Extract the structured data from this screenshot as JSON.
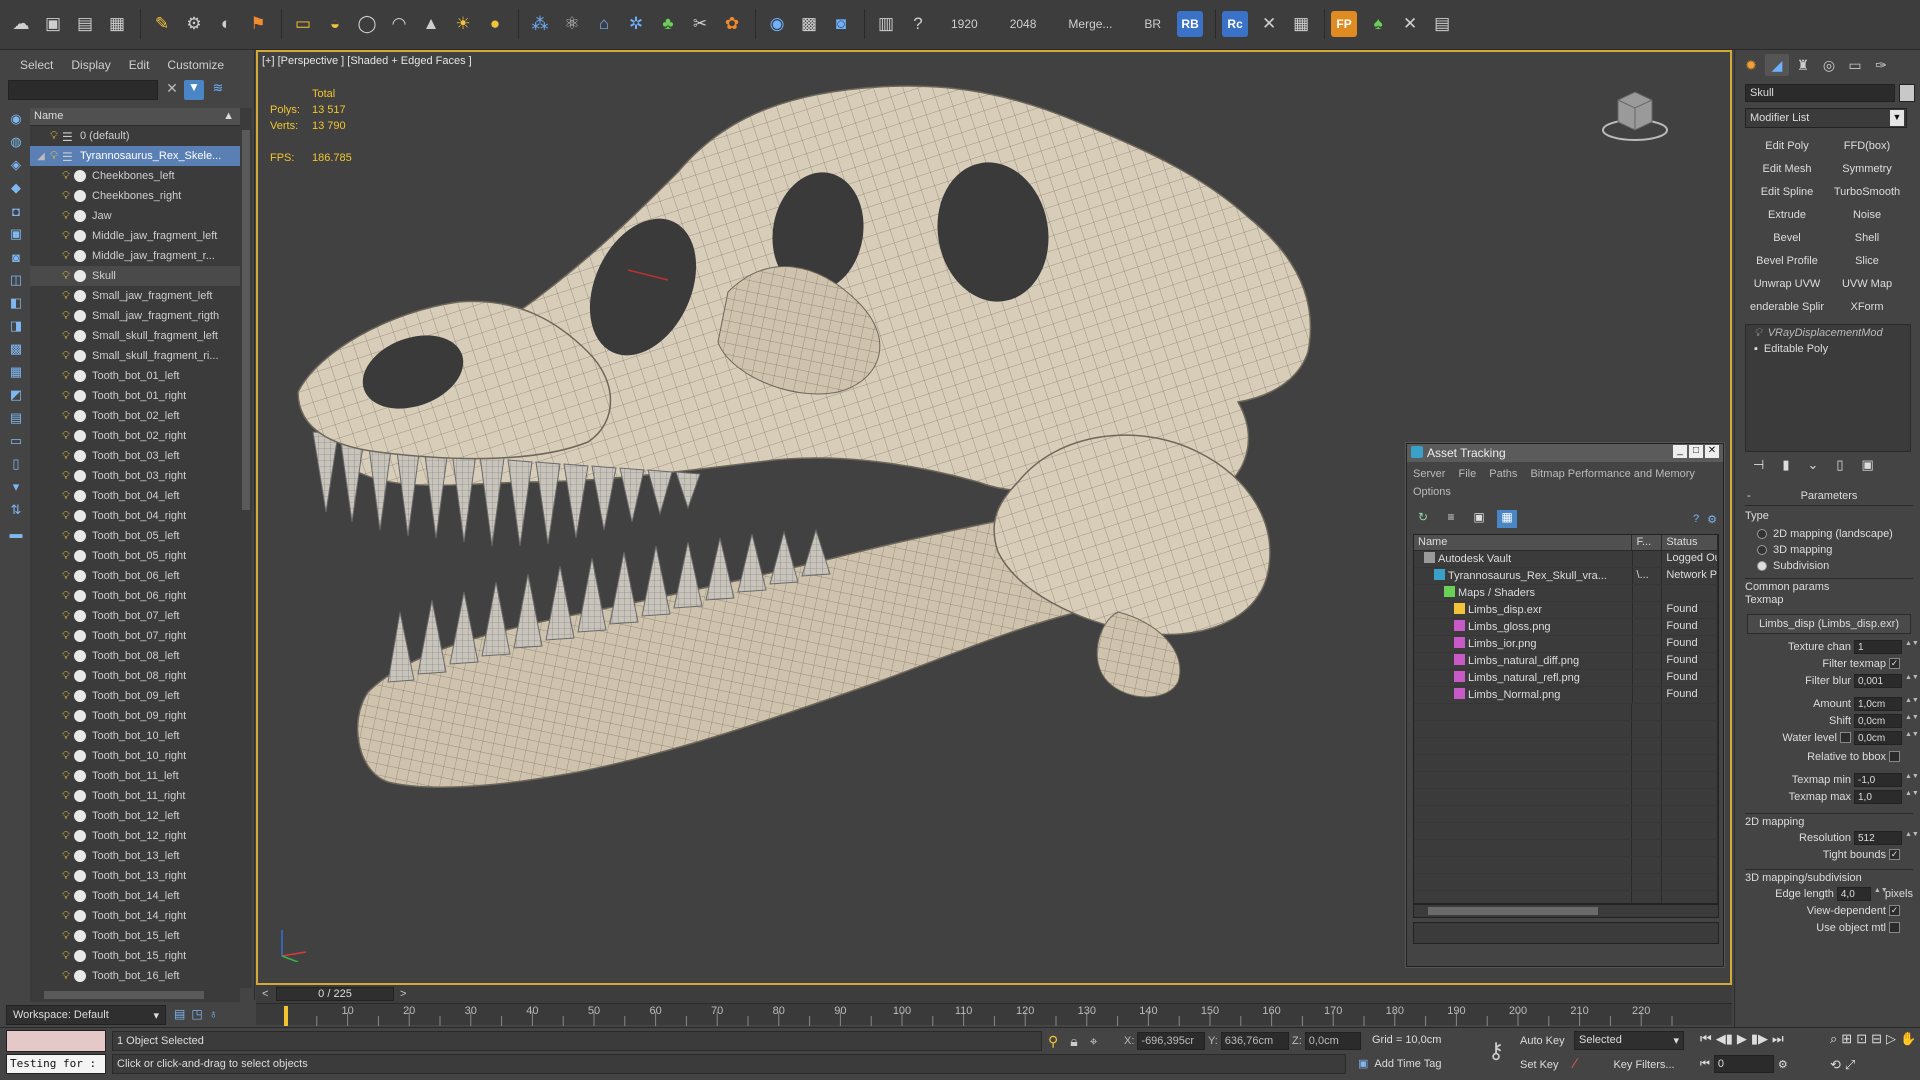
{
  "toolbar": {
    "res_width": "1920",
    "res_height": "2048",
    "merge_label": "Merge...",
    "br_label": "BR",
    "rb_badge": "RB",
    "rc_badge": "Rc",
    "fp_badge": "FP"
  },
  "explorer": {
    "menu": [
      "Select",
      "Display",
      "Edit",
      "Customize"
    ],
    "column_header": "Name",
    "rows": [
      {
        "label": "0 (default)",
        "type": "layer",
        "expanded": false
      },
      {
        "label": "Tyrannosaurus_Rex_Skele...",
        "type": "layer",
        "expanded": true,
        "highlight": true
      },
      {
        "label": "Cheekbones_left",
        "type": "object"
      },
      {
        "label": "Cheekbones_right",
        "type": "object"
      },
      {
        "label": "Jaw",
        "type": "object"
      },
      {
        "label": "Middle_jaw_fragment_left",
        "type": "object"
      },
      {
        "label": "Middle_jaw_fragment_r...",
        "type": "object"
      },
      {
        "label": "Skull",
        "type": "object",
        "selected": true
      },
      {
        "label": "Small_jaw_fragment_left",
        "type": "object"
      },
      {
        "label": "Small_jaw_fragment_rigth",
        "type": "object"
      },
      {
        "label": "Small_skull_fragment_left",
        "type": "object"
      },
      {
        "label": "Small_skull_fragment_ri...",
        "type": "object"
      },
      {
        "label": "Tooth_bot_01_left",
        "type": "object"
      },
      {
        "label": "Tooth_bot_01_right",
        "type": "object"
      },
      {
        "label": "Tooth_bot_02_left",
        "type": "object"
      },
      {
        "label": "Tooth_bot_02_right",
        "type": "object"
      },
      {
        "label": "Tooth_bot_03_left",
        "type": "object"
      },
      {
        "label": "Tooth_bot_03_right",
        "type": "object"
      },
      {
        "label": "Tooth_bot_04_left",
        "type": "object"
      },
      {
        "label": "Tooth_bot_04_right",
        "type": "object"
      },
      {
        "label": "Tooth_bot_05_left",
        "type": "object"
      },
      {
        "label": "Tooth_bot_05_right",
        "type": "object"
      },
      {
        "label": "Tooth_bot_06_left",
        "type": "object"
      },
      {
        "label": "Tooth_bot_06_right",
        "type": "object"
      },
      {
        "label": "Tooth_bot_07_left",
        "type": "object"
      },
      {
        "label": "Tooth_bot_07_right",
        "type": "object"
      },
      {
        "label": "Tooth_bot_08_left",
        "type": "object"
      },
      {
        "label": "Tooth_bot_08_right",
        "type": "object"
      },
      {
        "label": "Tooth_bot_09_left",
        "type": "object"
      },
      {
        "label": "Tooth_bot_09_right",
        "type": "object"
      },
      {
        "label": "Tooth_bot_10_left",
        "type": "object"
      },
      {
        "label": "Tooth_bot_10_right",
        "type": "object"
      },
      {
        "label": "Tooth_bot_11_left",
        "type": "object"
      },
      {
        "label": "Tooth_bot_11_right",
        "type": "object"
      },
      {
        "label": "Tooth_bot_12_left",
        "type": "object"
      },
      {
        "label": "Tooth_bot_12_right",
        "type": "object"
      },
      {
        "label": "Tooth_bot_13_left",
        "type": "object"
      },
      {
        "label": "Tooth_bot_13_right",
        "type": "object"
      },
      {
        "label": "Tooth_bot_14_left",
        "type": "object"
      },
      {
        "label": "Tooth_bot_14_right",
        "type": "object"
      },
      {
        "label": "Tooth_bot_15_left",
        "type": "object"
      },
      {
        "label": "Tooth_bot_15_right",
        "type": "object"
      },
      {
        "label": "Tooth_bot_16_left",
        "type": "object"
      }
    ],
    "workspace": "Workspace: Default"
  },
  "viewport": {
    "label": "[+] [Perspective ] [Shaded + Edged Faces ]",
    "stats_header": "Total",
    "polys_label": "Polys:",
    "polys_value": "13 517",
    "verts_label": "Verts:",
    "verts_value": "13 790",
    "fps_label": "FPS:",
    "fps_value": "186.785"
  },
  "timeline": {
    "frame_display": "0 / 225",
    "ticks": [
      "10",
      "20",
      "30",
      "40",
      "50",
      "60",
      "70",
      "80",
      "90",
      "100",
      "110",
      "120",
      "130",
      "140",
      "150",
      "160",
      "170",
      "180",
      "190",
      "200",
      "210",
      "220"
    ]
  },
  "status": {
    "maxscript_output": "Testing for :",
    "selection": "1 Object Selected",
    "prompt": "Click or click-and-drag to select objects",
    "x_label": "X:",
    "x_value": "-696,395cr",
    "y_label": "Y:",
    "y_value": "636,76cm",
    "z_label": "Z:",
    "z_value": "0,0cm",
    "grid": "Grid = 10,0cm",
    "add_time_tag": "Add Time Tag",
    "auto_key": "Auto Key",
    "auto_key_mode": "Selected",
    "set_key": "Set Key",
    "key_filters": "Key Filters...",
    "current_frame": "0"
  },
  "command_panel": {
    "object_name": "Skull",
    "modifier_list": "Modifier List",
    "modifier_buttons": [
      "Edit Poly",
      "FFD(box)",
      "Edit Mesh",
      "Symmetry",
      "Edit Spline",
      "TurboSmooth",
      "Extrude",
      "Noise",
      "Bevel",
      "Shell",
      "Bevel Profile",
      "Slice",
      "Unwrap UVW",
      "UVW Map",
      "enderable Splir",
      "XForm"
    ],
    "stack": [
      {
        "label": "VRayDisplacementMod",
        "italic": true
      },
      {
        "label": "Editable Poly",
        "italic": false
      }
    ],
    "params": {
      "title": "Parameters",
      "type_label": "Type",
      "types": [
        {
          "label": "2D mapping (landscape)",
          "on": false
        },
        {
          "label": "3D mapping",
          "on": false
        },
        {
          "label": "Subdivision",
          "on": true
        }
      ],
      "common_label": "Common params",
      "texmap_label": "Texmap",
      "texmap_value": "Limbs_disp (Limbs_disp.exr)",
      "texture_chan_label": "Texture chan",
      "texture_chan_value": "1",
      "filter_texmap_label": "Filter texmap",
      "filter_blur_label": "Filter blur",
      "filter_blur_value": "0,001",
      "amount_label": "Amount",
      "amount_value": "1,0cm",
      "shift_label": "Shift",
      "shift_value": "0,0cm",
      "water_level_label": "Water level",
      "water_level_value": "0,0cm",
      "relative_bbox_label": "Relative to bbox",
      "texmap_min_label": "Texmap min",
      "texmap_min_value": "-1,0",
      "texmap_max_label": "Texmap max",
      "texmap_max_value": "1,0",
      "mapping2d_label": "2D mapping",
      "resolution_label": "Resolution",
      "resolution_value": "512",
      "tight_bounds_label": "Tight bounds",
      "subdiv_label": "3D mapping/subdivision",
      "edge_length_label": "Edge length",
      "edge_length_value": "4,0",
      "pixels_label": "pixels",
      "view_dependent_label": "View-dependent",
      "use_object_mtl_label": "Use object mtl"
    }
  },
  "asset_tracking": {
    "title": "Asset Tracking",
    "menu": [
      "Server",
      "File",
      "Paths",
      "Bitmap Performance and Memory",
      "Options"
    ],
    "columns": [
      "Name",
      "F...",
      "Status"
    ],
    "rows": [
      {
        "name": "Autodesk Vault",
        "f": "",
        "status": "Logged Ou",
        "indent": 1,
        "icon": "vault"
      },
      {
        "name": "Tyrannosaurus_Rex_Skull_vra...",
        "f": "\\...",
        "status": "Network P",
        "indent": 2,
        "icon": "max"
      },
      {
        "name": "Maps / Shaders",
        "f": "",
        "status": "",
        "indent": 3,
        "icon": "maps"
      },
      {
        "name": "Limbs_disp.exr",
        "f": "",
        "status": "Found",
        "indent": 4,
        "icon": "exr"
      },
      {
        "name": "Limbs_gloss.png",
        "f": "",
        "status": "Found",
        "indent": 4,
        "icon": "png"
      },
      {
        "name": "Limbs_ior.png",
        "f": "",
        "status": "Found",
        "indent": 4,
        "icon": "png"
      },
      {
        "name": "Limbs_natural_diff.png",
        "f": "",
        "status": "Found",
        "indent": 4,
        "icon": "png"
      },
      {
        "name": "Limbs_natural_refl.png",
        "f": "",
        "status": "Found",
        "indent": 4,
        "icon": "png"
      },
      {
        "name": "Limbs_Normal.png",
        "f": "",
        "status": "Found",
        "indent": 4,
        "icon": "png"
      }
    ]
  },
  "colors": {
    "viewport_border": "#d4a93a",
    "stats_text": "#f2c530",
    "selection_highlight": "#5a7fb5",
    "bone": "#d9cfbe"
  }
}
